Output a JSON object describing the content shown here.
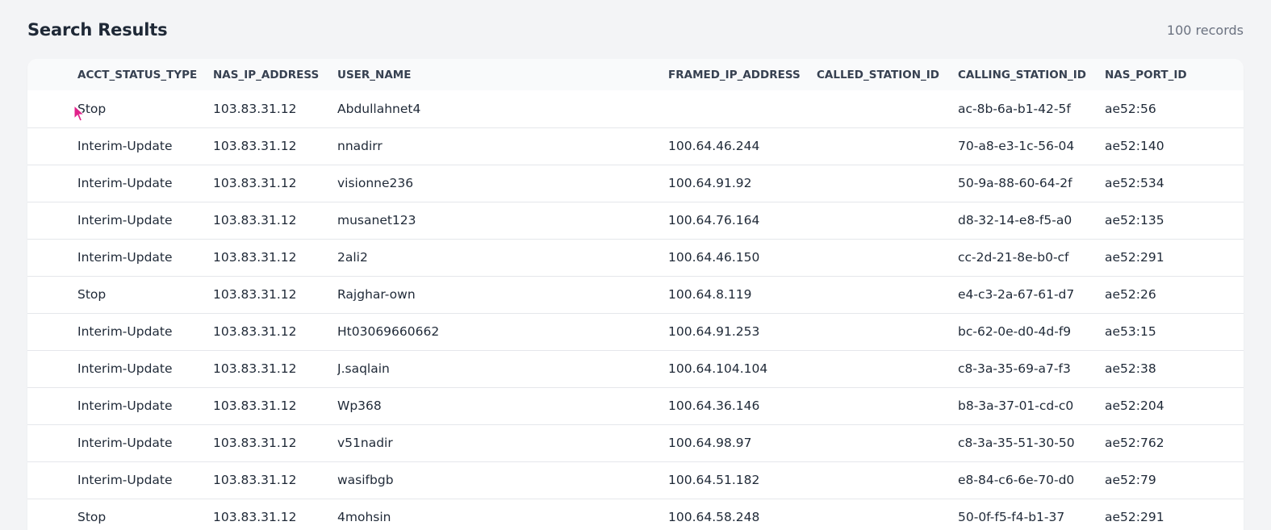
{
  "header": {
    "title": "Search Results",
    "record_count": "100 records"
  },
  "table": {
    "columns": [
      "ACCT_STATUS_TYPE",
      "NAS_IP_ADDRESS",
      "USER_NAME",
      "FRAMED_IP_ADDRESS",
      "CALLED_STATION_ID",
      "CALLING_STATION_ID",
      "NAS_PORT_ID"
    ],
    "rows": [
      [
        "Stop",
        "103.83.31.12",
        "Abdullahnet4",
        "",
        "",
        "ac-8b-6a-b1-42-5f",
        "ae52:56"
      ],
      [
        "Interim-Update",
        "103.83.31.12",
        "nnadirr",
        "100.64.46.244",
        "",
        "70-a8-e3-1c-56-04",
        "ae52:140"
      ],
      [
        "Interim-Update",
        "103.83.31.12",
        "visionne236",
        "100.64.91.92",
        "",
        "50-9a-88-60-64-2f",
        "ae52:534"
      ],
      [
        "Interim-Update",
        "103.83.31.12",
        "musanet123",
        "100.64.76.164",
        "",
        "d8-32-14-e8-f5-a0",
        "ae52:135"
      ],
      [
        "Interim-Update",
        "103.83.31.12",
        "2ali2",
        "100.64.46.150",
        "",
        "cc-2d-21-8e-b0-cf",
        "ae52:291"
      ],
      [
        "Stop",
        "103.83.31.12",
        "Rajghar-own",
        "100.64.8.119",
        "",
        "e4-c3-2a-67-61-d7",
        "ae52:26"
      ],
      [
        "Interim-Update",
        "103.83.31.12",
        "Ht03069660662",
        "100.64.91.253",
        "",
        "bc-62-0e-d0-4d-f9",
        "ae53:15"
      ],
      [
        "Interim-Update",
        "103.83.31.12",
        "J.saqlain",
        "100.64.104.104",
        "",
        "c8-3a-35-69-a7-f3",
        "ae52:38"
      ],
      [
        "Interim-Update",
        "103.83.31.12",
        "Wp368",
        "100.64.36.146",
        "",
        "b8-3a-37-01-cd-c0",
        "ae52:204"
      ],
      [
        "Interim-Update",
        "103.83.31.12",
        "v51nadir",
        "100.64.98.97",
        "",
        "c8-3a-35-51-30-50",
        "ae52:762"
      ],
      [
        "Interim-Update",
        "103.83.31.12",
        "wasifbgb",
        "100.64.51.182",
        "",
        "e8-84-c6-6e-70-d0",
        "ae52:79"
      ],
      [
        "Stop",
        "103.83.31.12",
        "4mohsin",
        "100.64.58.248",
        "",
        "50-0f-f5-f4-b1-37",
        "ae52:291"
      ]
    ]
  },
  "colors": {
    "background": "#f3f4f6",
    "card": "#ffffff",
    "header_row": "#f9fafb",
    "divider": "#e5e7eb",
    "cursor": "#e0218a"
  },
  "icons": {
    "cursor": "mouse-pointer-icon"
  }
}
